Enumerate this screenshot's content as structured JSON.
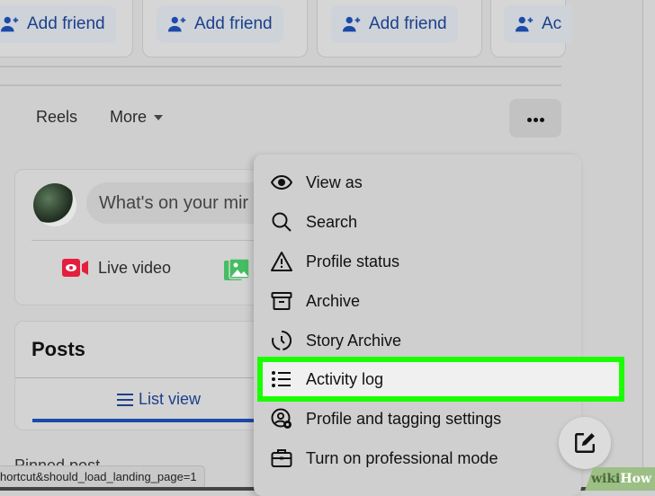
{
  "friend_suggestions": {
    "buttons": [
      "Add friend",
      "Add friend",
      "Add friend",
      "Ac"
    ]
  },
  "profile_tabs": {
    "reels": "Reels",
    "more": "More",
    "more_options_icon": "ellipsis-icon"
  },
  "composer": {
    "placeholder": "What's on your mir",
    "live_video": "Live video"
  },
  "posts": {
    "title": "Posts",
    "list_view": "List view",
    "pinned": "Pinned post"
  },
  "status_bar": {
    "url": "hortcut&should_load_landing_page=1"
  },
  "menu": {
    "items": [
      {
        "label": "View as",
        "icon": "eye-icon"
      },
      {
        "label": "Search",
        "icon": "search-icon"
      },
      {
        "label": "Profile status",
        "icon": "warning-icon"
      },
      {
        "label": "Archive",
        "icon": "archive-icon"
      },
      {
        "label": "Story Archive",
        "icon": "story-archive-icon"
      },
      {
        "label": "Activity log",
        "icon": "list-icon",
        "highlighted": true
      },
      {
        "label": "Profile and tagging settings",
        "icon": "profile-settings-icon"
      },
      {
        "label": "Turn on professional mode",
        "icon": "briefcase-icon"
      }
    ]
  },
  "colors": {
    "highlight": "#1aff00",
    "link_blue": "#1d3f8a",
    "live_red": "#e41e3f",
    "photo_green": "#45bd62"
  },
  "watermark": {
    "wiki": "wiki",
    "how": "How"
  }
}
